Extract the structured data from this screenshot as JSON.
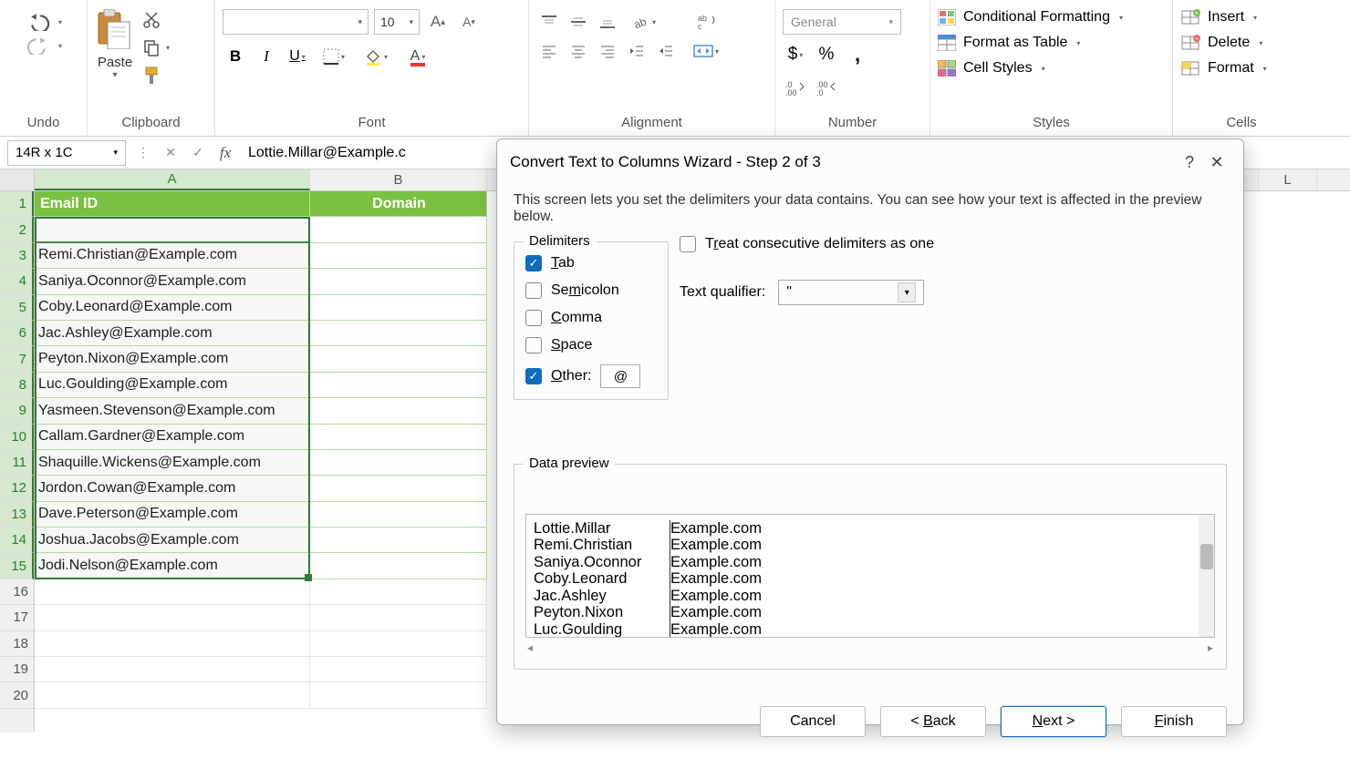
{
  "ribbon": {
    "undo_group": "Undo",
    "clipboard_group": "Clipboard",
    "paste_label": "Paste",
    "font_group": "Font",
    "font_size_value": "10",
    "alignment_group": "Alignment",
    "number_group": "Number",
    "number_format": "General",
    "styles_group": "Styles",
    "cond_fmt": "Conditional Formatting",
    "fmt_table": "Format as Table",
    "cell_styles": "Cell Styles",
    "cells_group": "Cells",
    "insert": "Insert",
    "delete": "Delete",
    "format": "Format"
  },
  "formula_bar": {
    "name_box": "14R x 1C",
    "formula": "Lottie.Millar@Example.c"
  },
  "sheet": {
    "headers": {
      "A": "Email ID",
      "B": "Domain"
    },
    "rows": [
      "Lottie.Millar@Example.com",
      "Remi.Christian@Example.com",
      "Saniya.Oconnor@Example.com",
      "Coby.Leonard@Example.com",
      "Jac.Ashley@Example.com",
      "Peyton.Nixon@Example.com",
      "Luc.Goulding@Example.com",
      "Yasmeen.Stevenson@Example.com",
      "Callam.Gardner@Example.com",
      "Shaquille.Wickens@Example.com",
      "Jordon.Cowan@Example.com",
      "Dave.Peterson@Example.com",
      "Joshua.Jacobs@Example.com",
      "Jodi.Nelson@Example.com"
    ]
  },
  "dialog": {
    "title": "Convert Text to Columns Wizard - Step 2 of 3",
    "description": "This screen lets you set the delimiters your data contains.  You can see how your text is affected in the preview below.",
    "delimiters_legend": "Delimiters",
    "tab_label": "Tab",
    "semicolon_label": "Semicolon",
    "comma_label": "Comma",
    "space_label": "Space",
    "other_label": "Other:",
    "other_value": "@",
    "consecutive_label": "Treat consecutive delimiters as one",
    "text_qualifier_label": "Text qualifier:",
    "text_qualifier_value": "\"",
    "preview_legend": "Data preview",
    "preview_rows": [
      {
        "c1": "Lottie.Millar",
        "c2": "Example.com"
      },
      {
        "c1": "Remi.Christian",
        "c2": "Example.com"
      },
      {
        "c1": "Saniya.Oconnor",
        "c2": "Example.com"
      },
      {
        "c1": "Coby.Leonard",
        "c2": "Example.com"
      },
      {
        "c1": "Jac.Ashley",
        "c2": "Example.com"
      },
      {
        "c1": "Peyton.Nixon",
        "c2": "Example.com"
      },
      {
        "c1": "Luc.Goulding",
        "c2": "Example.com"
      }
    ],
    "cancel": "Cancel",
    "back": "< Back",
    "next": "Next >",
    "finish": "Finish"
  }
}
